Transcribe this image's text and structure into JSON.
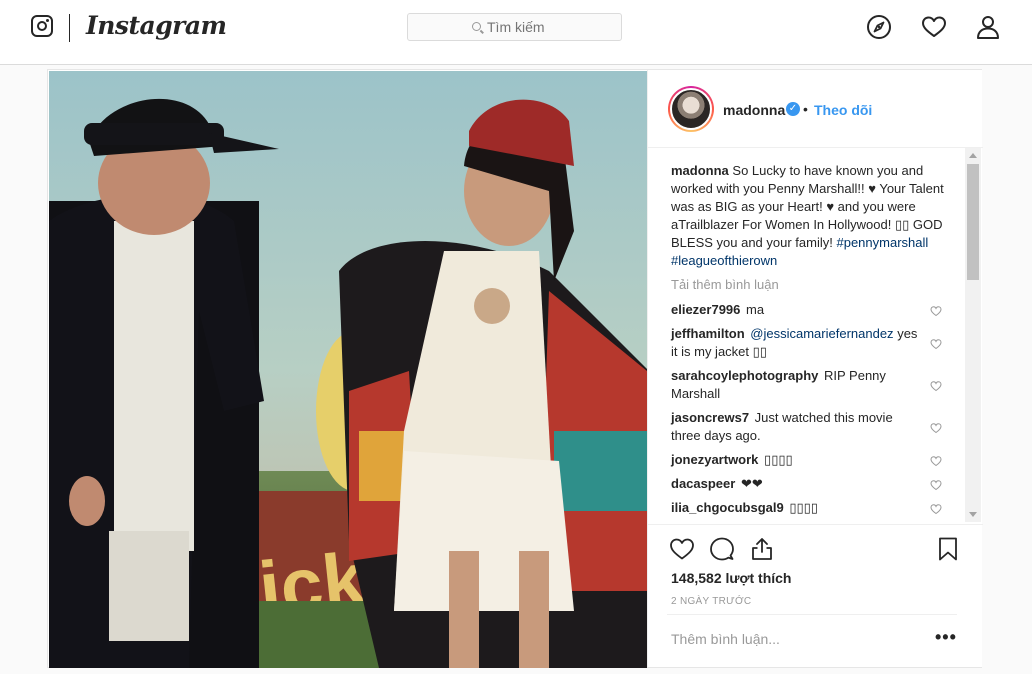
{
  "header": {
    "wordmark": "Instagram",
    "search_placeholder": "Tìm kiếm",
    "icons": [
      "instagram-glyph-icon",
      "compass-icon",
      "heart-icon",
      "profile-icon"
    ]
  },
  "post": {
    "username": "madonna",
    "verified": true,
    "separator": "•",
    "follow_label": "Theo dõi",
    "caption": {
      "username": "madonna",
      "text": "So Lucky to have known you and worked with you Penny Marshall!! ♥ Your Talent was as BIG as your Heart! ♥ and you were aTrailblazer For Women In Hollywood! ▯▯ GOD BLESS you and your family!",
      "hashtags": "#pennymarshall #leagueofthierown"
    },
    "load_more": "Tải thêm bình luận",
    "comments": [
      {
        "user": "eliezer7996",
        "text": "ma"
      },
      {
        "user": "jeffhamilton",
        "mention": "@jessicamariefernandez",
        "text": "yes it is my jacket ▯▯"
      },
      {
        "user": "sarahcoylephotography",
        "text": "RIP Penny Marshall"
      },
      {
        "user": "jasoncrews7",
        "text": "Just watched this movie three days ago."
      },
      {
        "user": "jonezyartwork",
        "text": "▯▯▯▯"
      },
      {
        "user": "dacaspeer",
        "text": "❤❤"
      },
      {
        "user": "ilia_chgocubsgal9",
        "text": "▯▯▯▯"
      }
    ],
    "likes": "148,582 lượt thích",
    "time_ago": "2 NGÀY TRƯỚC",
    "add_comment_placeholder": "Thêm bình luận...",
    "more_label": "•••"
  },
  "colors": {
    "accent": "#3897f0",
    "text": "#262626",
    "muted": "#999999",
    "link": "#003569"
  }
}
